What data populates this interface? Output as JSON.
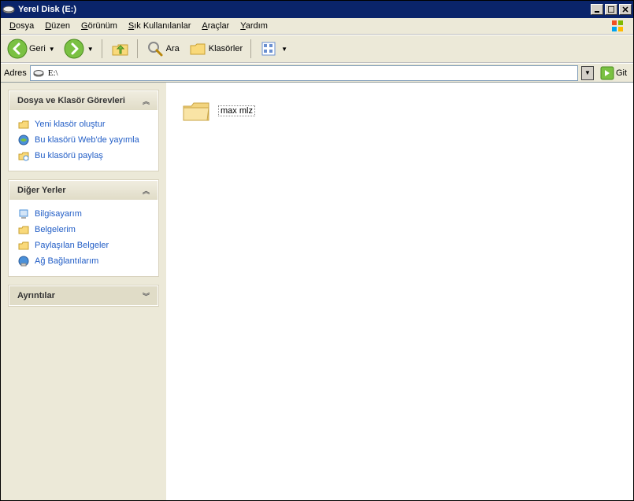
{
  "titlebar": {
    "title": "Yerel Disk (E:)"
  },
  "menubar": {
    "items": [
      "Dosya",
      "Düzen",
      "Görünüm",
      "Sık Kullanılanlar",
      "Araçlar",
      "Yardım"
    ]
  },
  "toolbar": {
    "back": "Geri",
    "search": "Ara",
    "folders": "Klasörler"
  },
  "addressbar": {
    "label": "Adres",
    "value": "E:\\",
    "go": "Git"
  },
  "sidebar": {
    "tasks": {
      "title": "Dosya ve Klasör Görevleri",
      "items": [
        "Yeni klasör oluştur",
        "Bu klasörü Web'de yayımla",
        "Bu klasörü paylaş"
      ]
    },
    "places": {
      "title": "Diğer Yerler",
      "items": [
        "Bilgisayarım",
        "Belgelerim",
        "Paylaşılan Belgeler",
        "Ağ Bağlantılarım"
      ]
    },
    "details": {
      "title": "Ayrıntılar"
    }
  },
  "main": {
    "folder": {
      "name": "max mlz"
    }
  }
}
